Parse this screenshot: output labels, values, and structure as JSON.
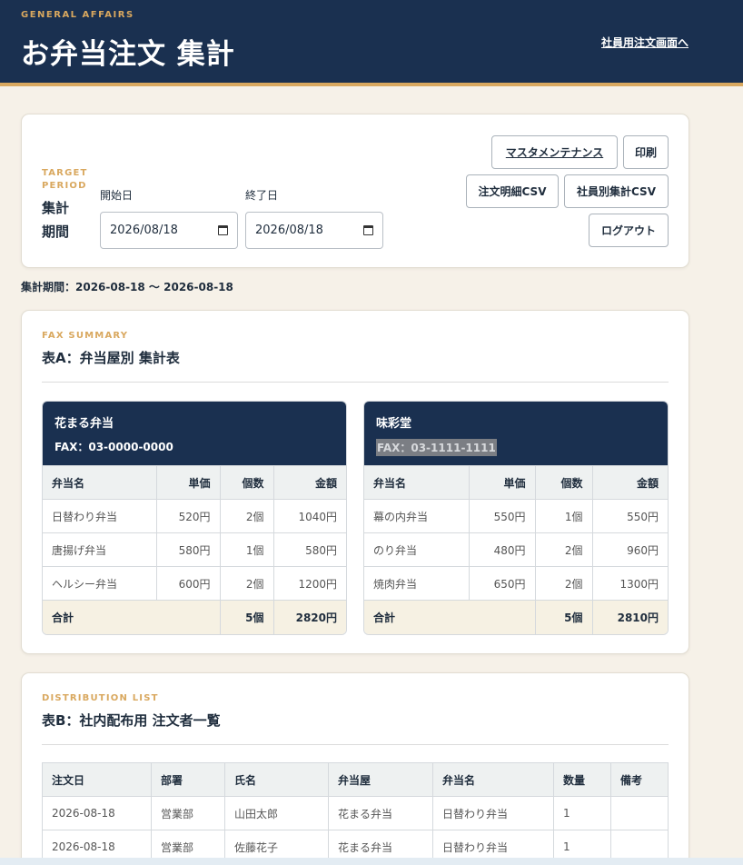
{
  "header": {
    "eyebrow": "GENERAL AFFAIRS",
    "title": "お弁当注文 集計",
    "employee_link": "社員用注文画面へ"
  },
  "period": {
    "eyebrow": "TARGET PERIOD",
    "title": "集計期間",
    "start_label": "開始日",
    "start_value": "2026/08/18",
    "end_label": "終了日",
    "end_value": "2026/08/18",
    "buttons": {
      "master": "マスタメンテナンス",
      "print": "印刷",
      "detail_csv": "注文明細CSV",
      "employee_csv": "社員別集計CSV",
      "logout": "ログアウト"
    },
    "summary_text": "集計期間：2026-08-18 〜 2026-08-18"
  },
  "fax_summary": {
    "eyebrow": "FAX SUMMARY",
    "title": "表A：弁当屋別 集計表",
    "columns": [
      "弁当名",
      "単価",
      "個数",
      "金額"
    ],
    "total_label": "合計",
    "vendors": [
      {
        "name": "花まる弁当",
        "fax": "FAX：03-0000-0000",
        "rows": [
          [
            "日替わり弁当",
            "520円",
            "2個",
            "1040円"
          ],
          [
            "唐揚げ弁当",
            "580円",
            "1個",
            "580円"
          ],
          [
            "ヘルシー弁当",
            "600円",
            "2個",
            "1200円"
          ]
        ],
        "total_count": "5個",
        "total_amount": "2820円"
      },
      {
        "name": "味彩堂",
        "fax": "FAX：03-1111-1111",
        "rows": [
          [
            "幕の内弁当",
            "550円",
            "1個",
            "550円"
          ],
          [
            "のり弁当",
            "480円",
            "2個",
            "960円"
          ],
          [
            "焼肉弁当",
            "650円",
            "2個",
            "1300円"
          ]
        ],
        "total_count": "5個",
        "total_amount": "2810円"
      }
    ]
  },
  "distribution": {
    "eyebrow": "DISTRIBUTION LIST",
    "title": "表B：社内配布用 注文者一覧",
    "columns": [
      "注文日",
      "部署",
      "氏名",
      "弁当屋",
      "弁当名",
      "数量",
      "備考"
    ],
    "rows": [
      [
        "2026-08-18",
        "営業部",
        "山田太郎",
        "花まる弁当",
        "日替わり弁当",
        "1",
        ""
      ],
      [
        "2026-08-18",
        "営業部",
        "佐藤花子",
        "花まる弁当",
        "日替わり弁当",
        "1",
        ""
      ]
    ]
  }
}
